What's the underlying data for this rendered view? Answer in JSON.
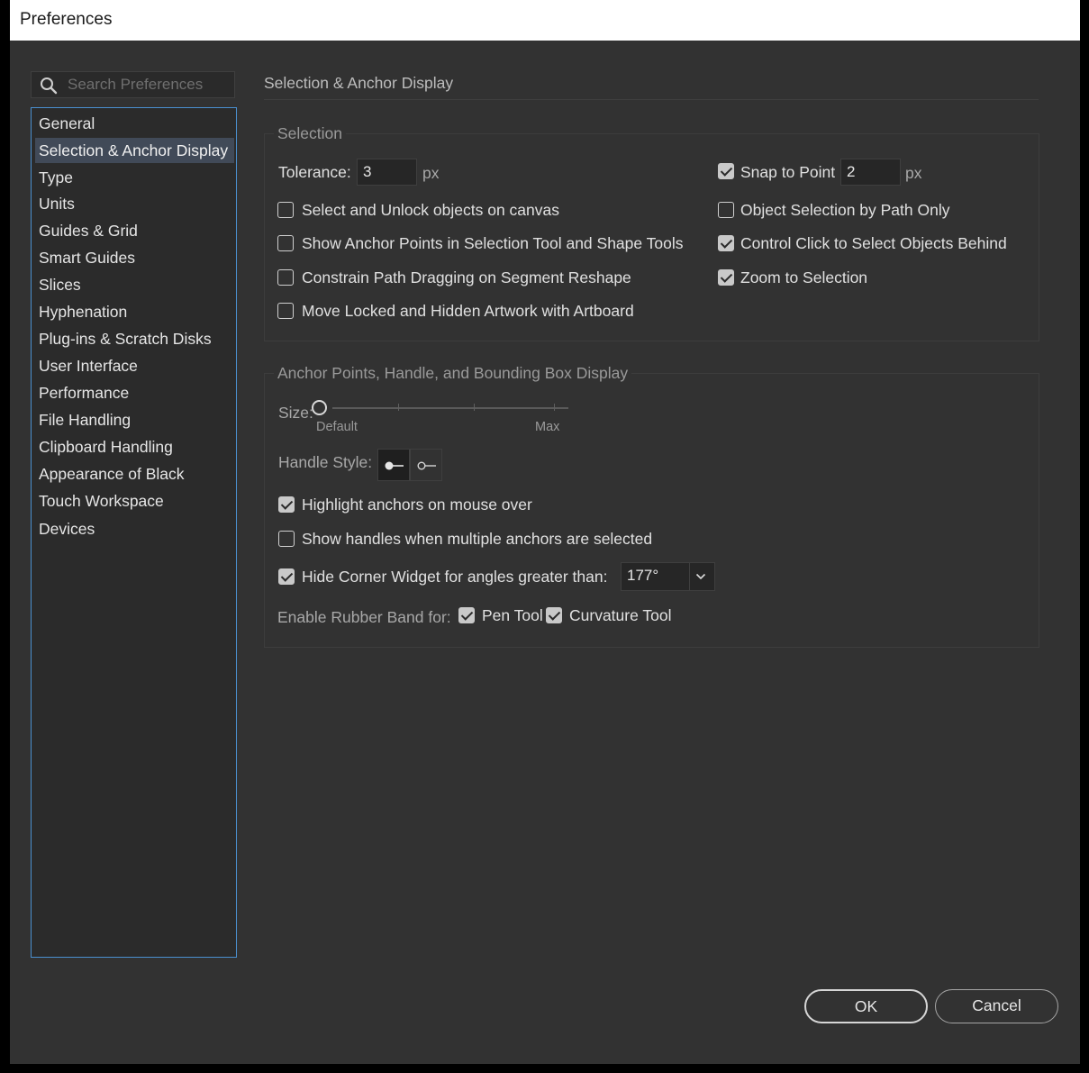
{
  "window": {
    "title": "Preferences"
  },
  "search": {
    "placeholder": "Search Preferences"
  },
  "nav": {
    "items": [
      "General",
      "Selection & Anchor Display",
      "Type",
      "Units",
      "Guides & Grid",
      "Smart Guides",
      "Slices",
      "Hyphenation",
      "Plug-ins & Scratch Disks",
      "User Interface",
      "Performance",
      "File Handling",
      "Clipboard Handling",
      "Appearance of Black",
      "Touch Workspace",
      "Devices"
    ],
    "active": "Selection & Anchor Display"
  },
  "page": {
    "header": "Selection & Anchor Display"
  },
  "selection": {
    "title": "Selection",
    "tolerance_label": "Tolerance:",
    "tolerance_value": "3",
    "tolerance_unit": "px",
    "snap_label": "Snap to Point",
    "snap_checked": true,
    "snap_value": "2",
    "snap_unit": "px",
    "options_left": [
      {
        "label": "Select and Unlock objects on canvas",
        "checked": false
      },
      {
        "label": "Show Anchor Points in Selection Tool and Shape Tools",
        "checked": false
      },
      {
        "label": "Constrain Path Dragging on Segment Reshape",
        "checked": false
      },
      {
        "label": "Move Locked and Hidden Artwork with Artboard",
        "checked": false
      }
    ],
    "options_right": [
      {
        "label": "Object Selection by Path Only",
        "checked": false
      },
      {
        "label": "Control Click to Select Objects Behind",
        "checked": true
      },
      {
        "label": "Zoom to Selection",
        "checked": true
      }
    ]
  },
  "anchor": {
    "title": "Anchor Points, Handle, and Bounding Box Display",
    "size_label": "Size:",
    "size_min_label": "Default",
    "size_max_label": "Max",
    "size_value_fraction": 0,
    "handle_style_label": "Handle Style:",
    "handle_style_selected": "solid-handle",
    "highlight": {
      "label": "Highlight anchors on mouse over",
      "checked": true
    },
    "show_handles": {
      "label": "Show handles when multiple anchors are selected",
      "checked": false
    },
    "hide_corner": {
      "label": "Hide Corner Widget for angles greater than:",
      "checked": true,
      "value": "177°"
    },
    "rubber_band_label": "Enable Rubber Band for:",
    "pen_tool": {
      "label": "Pen Tool",
      "checked": true
    },
    "curvature_tool": {
      "label": "Curvature Tool",
      "checked": true
    }
  },
  "buttons": {
    "ok": "OK",
    "cancel": "Cancel"
  },
  "colors": {
    "background": "#323232",
    "accent": "#4a90d0",
    "nav_active": "#414a58"
  }
}
